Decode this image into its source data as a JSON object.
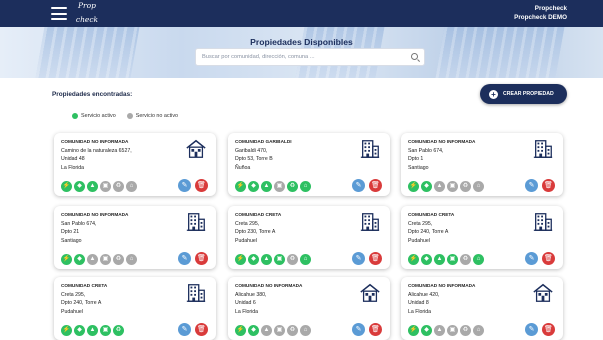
{
  "header": {
    "logo_line1": "Prop",
    "logo_line2": "check",
    "user_name": "Propcheck",
    "user_company": "Propcheck DEMO"
  },
  "hero": {
    "title": "Propiedades Disponibles",
    "search_placeholder": "Buscar por comunidad, dirección, comuna ..."
  },
  "list": {
    "found_label": "Propiedades encontradas:",
    "create_label": "CREAR PROPIEDAD"
  },
  "legend": {
    "active": "Servicio activo",
    "inactive": "Servicio no activo",
    "active_color": "#2ec062",
    "inactive_color": "#a9a9a9"
  },
  "cards": [
    {
      "community": "COMUNIDAD NO INFORMADA",
      "address": "Camino de la naturaleza 6527,",
      "unit": "Unidad 48",
      "commune": "La Florida",
      "icon": "house-icon",
      "services": [
        1,
        1,
        1,
        0,
        0,
        0
      ]
    },
    {
      "community": "COMUNIDAD GARIBALDI",
      "address": "Garibaldi 470,",
      "unit": "Dpto 53, Torre B",
      "commune": "Ñuñoa",
      "icon": "building-icon",
      "services": [
        1,
        1,
        1,
        0,
        1,
        1
      ]
    },
    {
      "community": "COMUNIDAD NO INFORMADA",
      "address": "San Pablo 674,",
      "unit": "Dpto 1",
      "commune": "Santiago",
      "icon": "building-icon",
      "services": [
        1,
        1,
        0,
        0,
        0,
        0
      ]
    },
    {
      "community": "COMUNIDAD NO INFORMADA",
      "address": "San Pablo 674,",
      "unit": "Dpto 21",
      "commune": "Santiago",
      "icon": "building-icon",
      "services": [
        1,
        1,
        0,
        0,
        0,
        0
      ]
    },
    {
      "community": "COMUNIDAD CRETA",
      "address": "Creta 295,",
      "unit": "Dpto 230, Torre A",
      "commune": "Pudahuel",
      "icon": "building-icon",
      "services": [
        1,
        1,
        1,
        1,
        0,
        1
      ]
    },
    {
      "community": "COMUNIDAD CRETA",
      "address": "Creta 295,",
      "unit": "Dpto 240, Torre A",
      "commune": "Pudahuel",
      "icon": "building-icon",
      "services": [
        1,
        1,
        1,
        1,
        0,
        1
      ]
    },
    {
      "community": "COMUNIDAD CRETA",
      "address": "Creta 295,",
      "unit": "Dpto 240, Torre A",
      "commune": "Pudahuel",
      "icon": "building-icon",
      "services": [
        1,
        1,
        1,
        1,
        1
      ]
    },
    {
      "community": "COMUNIDAD NO INFORMADA",
      "address": "Alicahue 380,",
      "unit": "Unidad 6",
      "commune": "La Florida",
      "icon": "house-icon",
      "services": [
        1,
        1,
        0,
        0,
        0,
        0
      ]
    },
    {
      "community": "COMUNIDAD NO INFORMADA",
      "address": "Alicahue 420,",
      "unit": "Unidad 8",
      "commune": "La Florida",
      "icon": "house-icon",
      "services": [
        1,
        1,
        0,
        0,
        0,
        0
      ]
    }
  ],
  "service_icons": [
    "⚡",
    "◆",
    "▲",
    "▣",
    "♻",
    "⌂"
  ]
}
